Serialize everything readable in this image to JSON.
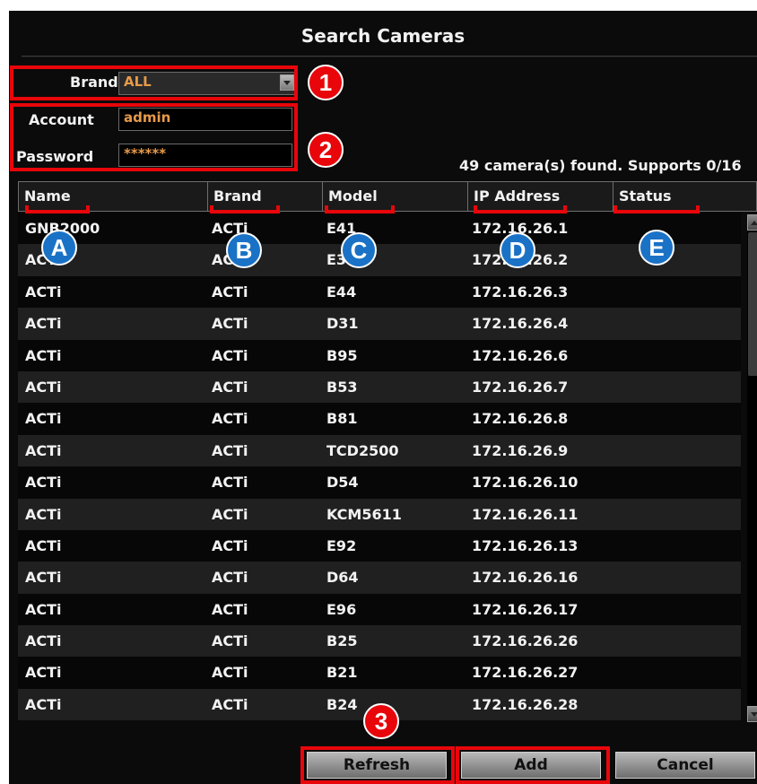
{
  "dialog": {
    "title": "Search Cameras"
  },
  "brand": {
    "label": "Brand",
    "value": "ALL"
  },
  "account": {
    "label": "Account",
    "value": "admin"
  },
  "password": {
    "label": "Password",
    "value": "******"
  },
  "status_text": "49 camera(s) found.  Supports 0/16",
  "table": {
    "headers": [
      "Name",
      "Brand",
      "Model",
      "IP Address",
      "Status"
    ],
    "rows": [
      [
        "GNB2000",
        "ACTi",
        "E41",
        "172.16.26.1",
        ""
      ],
      [
        "ACTi",
        "ACTi",
        "E33",
        "172.16.26.2",
        ""
      ],
      [
        "ACTi",
        "ACTi",
        "E44",
        "172.16.26.3",
        ""
      ],
      [
        "ACTi",
        "ACTi",
        "D31",
        "172.16.26.4",
        ""
      ],
      [
        "ACTi",
        "ACTi",
        "B95",
        "172.16.26.6",
        ""
      ],
      [
        "ACTi",
        "ACTi",
        "B53",
        "172.16.26.7",
        ""
      ],
      [
        "ACTi",
        "ACTi",
        "B81",
        "172.16.26.8",
        ""
      ],
      [
        "ACTi",
        "ACTi",
        "TCD2500",
        "172.16.26.9",
        ""
      ],
      [
        "ACTi",
        "ACTi",
        "D54",
        "172.16.26.10",
        ""
      ],
      [
        "ACTi",
        "ACTi",
        "KCM5611",
        "172.16.26.11",
        ""
      ],
      [
        "ACTi",
        "ACTi",
        "E92",
        "172.16.26.13",
        ""
      ],
      [
        "ACTi",
        "ACTi",
        "D64",
        "172.16.26.16",
        ""
      ],
      [
        "ACTi",
        "ACTi",
        "E96",
        "172.16.26.17",
        ""
      ],
      [
        "ACTi",
        "ACTi",
        "B25",
        "172.16.26.26",
        ""
      ],
      [
        "ACTi",
        "ACTi",
        "B21",
        "172.16.26.27",
        ""
      ],
      [
        "ACTi",
        "ACTi",
        "B24",
        "172.16.26.28",
        ""
      ]
    ]
  },
  "buttons": {
    "refresh": "Refresh",
    "add": "Add",
    "cancel": "Cancel"
  },
  "callouts": {
    "numbered": [
      "1",
      "2",
      "3"
    ],
    "lettered": [
      "A",
      "B",
      "C",
      "D",
      "E"
    ]
  },
  "colors": {
    "background": "#0b0b0b",
    "text": "#f2f2f2",
    "field_text": "#e79a4a",
    "highlight_red": "#e8060b",
    "callout_blue": "#1a72c6"
  },
  "icons": {
    "dropdown": "chevron-down-icon",
    "scroll_up": "arrow-up-icon",
    "scroll_down": "arrow-down-icon"
  }
}
